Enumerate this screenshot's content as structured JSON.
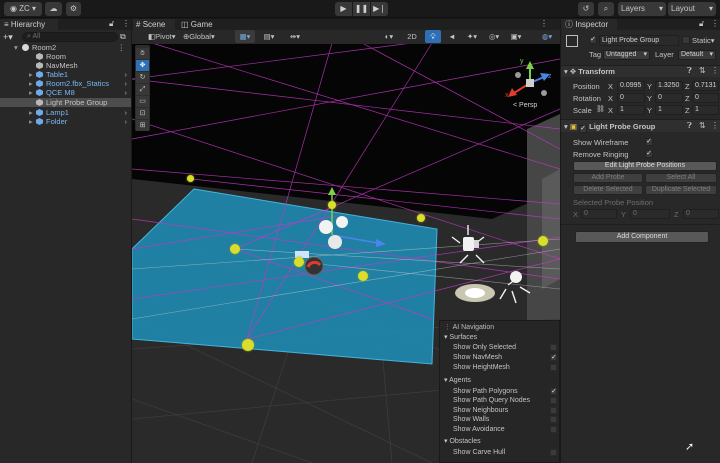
{
  "toolbar": {
    "account": "ZC",
    "layers": "Layers",
    "layout": "Layout"
  },
  "hierarchy": {
    "tab": "Hierarchy",
    "search_placeholder": "All",
    "root": "Room2",
    "items": [
      {
        "label": "Room",
        "color": "grey"
      },
      {
        "label": "NavMesh",
        "color": "grey"
      },
      {
        "label": "Table1",
        "color": "blue"
      },
      {
        "label": "Room2.fbx_Statics",
        "color": "blue"
      },
      {
        "label": "QCE M8",
        "color": "blue"
      },
      {
        "label": "Light Probe Group",
        "color": "grey"
      },
      {
        "label": "Lamp1",
        "color": "blue"
      },
      {
        "label": "Folder",
        "color": "blue"
      }
    ]
  },
  "scene": {
    "tabs": [
      "Scene",
      "Game"
    ],
    "pivot": "Pivot",
    "global": "Global",
    "mode_2d": "2D",
    "persp": "< Persp",
    "gizmo_axes": {
      "x": "x",
      "y": "y",
      "z": "z"
    }
  },
  "ai_navigation": {
    "title": "AI Navigation",
    "surfaces_header": "Surfaces",
    "surfaces": [
      {
        "label": "Show Only Selected",
        "checked": false
      },
      {
        "label": "Show NavMesh",
        "checked": true
      },
      {
        "label": "Show HeightMesh",
        "checked": false
      }
    ],
    "agents_header": "Agents",
    "agents": [
      {
        "label": "Show Path Polygons",
        "checked": true
      },
      {
        "label": "Show Path Query Nodes",
        "checked": false
      },
      {
        "label": "Show Neighbours",
        "checked": false
      },
      {
        "label": "Show Walls",
        "checked": false
      },
      {
        "label": "Show Avoidance",
        "checked": false
      }
    ],
    "obstacles_header": "Obstacles",
    "obstacles": [
      {
        "label": "Show Carve Hull",
        "checked": false
      }
    ]
  },
  "inspector": {
    "tab": "Inspector",
    "object_name": "Light Probe Group",
    "static_label": "Static",
    "tag_label": "Tag",
    "tag_value": "Untagged",
    "layer_label": "Layer",
    "layer_value": "Default",
    "transform": {
      "title": "Transform",
      "position_label": "Position",
      "rotation_label": "Rotation",
      "scale_label": "Scale",
      "position": {
        "x": "0.0995",
        "y": "1.3250",
        "z": "0.7131"
      },
      "rotation": {
        "x": "0",
        "y": "0",
        "z": "0"
      },
      "scale": {
        "x": "1",
        "y": "1",
        "z": "1"
      }
    },
    "component": {
      "title": "Light Probe Group",
      "show_wireframe_label": "Show Wireframe",
      "remove_ringing_label": "Remove Ringing",
      "edit_button": "Edit Light Probe Positions",
      "add_probe": "Add Probe",
      "select_all": "Select All",
      "delete_selected": "Delete Selected",
      "duplicate_selected": "Duplicate Selected",
      "selected_pos_label": "Selected Probe Position",
      "selected_pos": {
        "x": "0",
        "y": "0",
        "z": "0"
      }
    },
    "add_component": "Add Component"
  },
  "axis_labels": {
    "x": "X",
    "y": "Y",
    "z": "Z"
  },
  "colors": {
    "accent_blue": "#2f7bd1",
    "nav_floor": "#1f8fb8",
    "probe_yellow": "#d9dd2b",
    "wire_magenta": "#c637c6"
  }
}
